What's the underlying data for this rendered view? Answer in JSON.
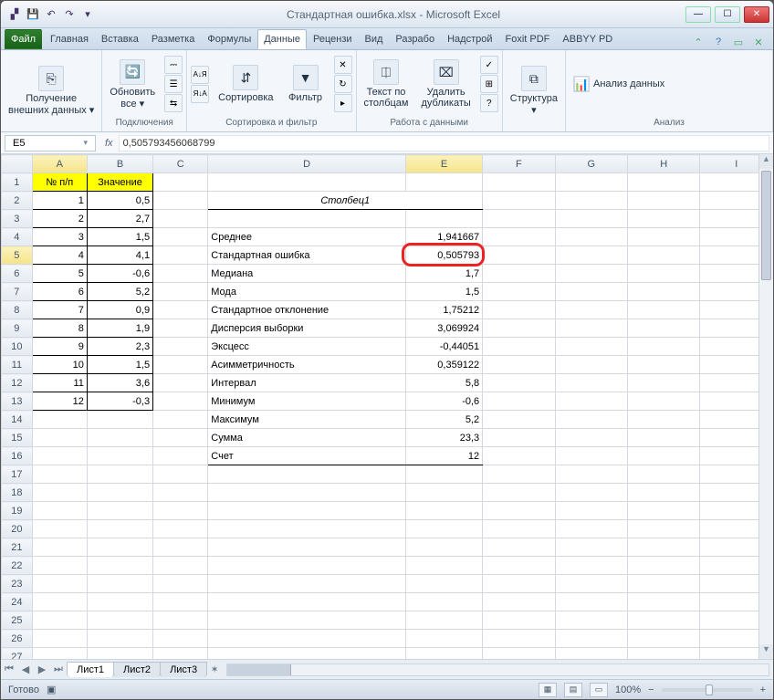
{
  "window": {
    "title": "Стандартная ошибка.xlsx - Microsoft Excel"
  },
  "tabs": {
    "file": "Файл",
    "list": [
      "Главная",
      "Вставка",
      "Разметка",
      "Формулы",
      "Данные",
      "Рецензи",
      "Вид",
      "Разрабо",
      "Надстрой",
      "Foxit PDF",
      "ABBYY PD"
    ],
    "active": "Данные"
  },
  "ribbon": {
    "g1": {
      "btn": "Получение\nвнешних данных ▾"
    },
    "g2": {
      "btn": "Обновить\nвсе ▾",
      "label": "Подключения"
    },
    "g3": {
      "sort": "Сортировка",
      "filter": "Фильтр",
      "label": "Сортировка и фильтр"
    },
    "g4": {
      "ttc": "Текст по\nстолбцам",
      "dup": "Удалить\nдубликаты",
      "label": "Работа с данными"
    },
    "g5": {
      "btn": "Структура\n▾"
    },
    "g6": {
      "btn": "Анализ данных",
      "label": "Анализ"
    }
  },
  "formula": {
    "namebox": "E5",
    "value": "0,505793456068799",
    "fx": "fx"
  },
  "headers": {
    "cols": [
      "A",
      "B",
      "C",
      "D",
      "E",
      "F",
      "G",
      "H",
      "I"
    ]
  },
  "data": {
    "h1": "№ п/п",
    "h2": "Значение",
    "rows": [
      {
        "n": "1",
        "v": "0,5"
      },
      {
        "n": "2",
        "v": "2,7"
      },
      {
        "n": "3",
        "v": "1,5"
      },
      {
        "n": "4",
        "v": "4,1"
      },
      {
        "n": "5",
        "v": "-0,6"
      },
      {
        "n": "6",
        "v": "5,2"
      },
      {
        "n": "7",
        "v": "0,9"
      },
      {
        "n": "8",
        "v": "1,9"
      },
      {
        "n": "9",
        "v": "2,3"
      },
      {
        "n": "10",
        "v": "1,5"
      },
      {
        "n": "11",
        "v": "3,6"
      },
      {
        "n": "12",
        "v": "-0,3"
      }
    ],
    "statsTitle": "Столбец1",
    "stats": [
      {
        "l": "Среднее",
        "v": "1,941667"
      },
      {
        "l": "Стандартная ошибка",
        "v": "0,505793"
      },
      {
        "l": "Медиана",
        "v": "1,7"
      },
      {
        "l": "Мода",
        "v": "1,5"
      },
      {
        "l": "Стандартное отклонение",
        "v": "1,75212"
      },
      {
        "l": "Дисперсия выборки",
        "v": "3,069924"
      },
      {
        "l": "Эксцесс",
        "v": "-0,44051"
      },
      {
        "l": "Асимметричность",
        "v": "0,359122"
      },
      {
        "l": "Интервал",
        "v": "5,8"
      },
      {
        "l": "Минимум",
        "v": "-0,6"
      },
      {
        "l": "Максимум",
        "v": "5,2"
      },
      {
        "l": "Сумма",
        "v": "23,3"
      },
      {
        "l": "Счет",
        "v": "12"
      }
    ]
  },
  "sheets": [
    "Лист1",
    "Лист2",
    "Лист3"
  ],
  "status": {
    "ready": "Готово",
    "zoom": "100%"
  },
  "selected_cell": "E5"
}
